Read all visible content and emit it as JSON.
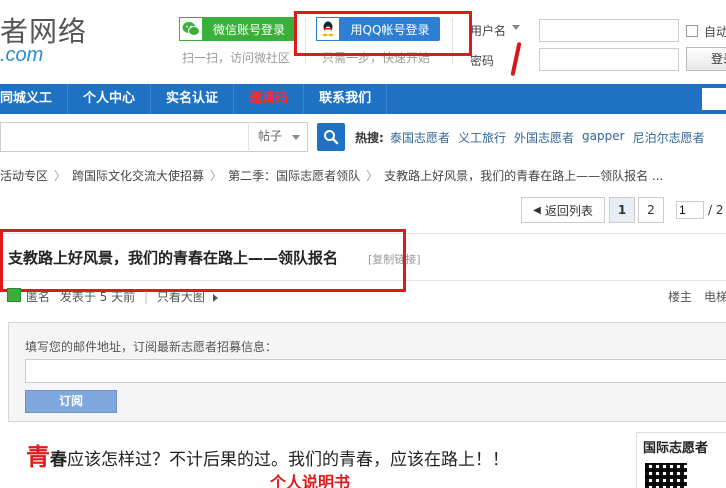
{
  "header": {
    "logo_text": "者网络",
    "logo_sub": ".com",
    "wechat_label": "微信账号登录",
    "wechat_hint": "扫一扫，访问微社区",
    "qq_label": "用QQ帐号登录",
    "qq_hint": "只需一步，快速开始",
    "username_label": "用户名",
    "password_label": "密码",
    "username_value": "",
    "password_value": "",
    "auto_login_label": "自动",
    "login_button": "登录"
  },
  "nav": {
    "items": [
      "同城义工",
      "个人中心",
      "实名认证",
      "邀请码",
      "联系我们"
    ]
  },
  "search": {
    "type_label": "帖子",
    "hot_label": "热搜:",
    "hot_links": [
      "泰国志愿者",
      "义工旅行",
      "外国志愿者",
      "gapper",
      "尼泊尔志愿者"
    ]
  },
  "breadcrumb": [
    "活动专区",
    "跨国际文化交流大使招募",
    "第二季：国际志愿者领队",
    "支教路上好风景，我们的青春在路上——领队报名 ..."
  ],
  "pager": {
    "back_label": "返回列表",
    "pages": [
      "1",
      "2"
    ],
    "current_page": "1",
    "total": "/ 2"
  },
  "thread": {
    "title": "支教路上好风景，我们的青春在路上——领队报名",
    "copy_link": "[复制链接]",
    "author": "匿名",
    "posted": "发表于 5 天前",
    "only_author": "只看大图",
    "floor_label": "楼主",
    "ecard_label": "电梯"
  },
  "subscribe": {
    "label": "填写您的邮件地址，订阅最新志愿者招募信息：",
    "email_value": "",
    "button": "订阅"
  },
  "post": {
    "first_char": "青",
    "second_char": "春",
    "line_rest": "应该怎样过？不计后果的过。我们的青春，应该在路上！！",
    "subtitle": "个人说明书",
    "qr_title": "国际志愿者"
  },
  "colors": {
    "nav_blue": "#1f71c4",
    "wechat_green": "#3aaf3a",
    "qq_blue": "#2e7fd1",
    "annotation_red": "#e01a1a"
  }
}
